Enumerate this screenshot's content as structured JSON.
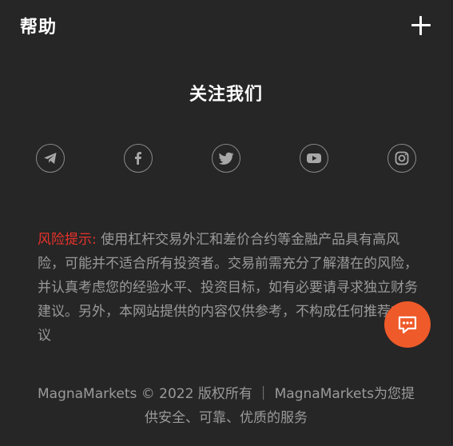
{
  "help": {
    "title": "帮助",
    "expand_icon": "plus-icon"
  },
  "follow": {
    "title": "关注我们",
    "icons": [
      "telegram-icon",
      "facebook-icon",
      "twitter-icon",
      "youtube-icon",
      "instagram-icon"
    ]
  },
  "risk": {
    "label": "风险提示:",
    "text": " 使用杠杆交易外汇和差价合约等金融产品具有高风险，可能并不适合所有投资者。交易前需充分了解潜在的风险，并认真考虑您的经验水平、投资目标，如有必要请寻求独立财务建议。另外，本网站提供的内容仅供参考，不构成任何推荐或建议"
  },
  "chat": {
    "icon": "chat-bubble-icon"
  },
  "footer": {
    "copyright": "MagnaMarkets © 2022 版权所有 ｜ MagnaMarkets为您提供安全、可靠、优质的服务"
  },
  "colors": {
    "background": "#262626",
    "risk_label": "#e8322b",
    "chat_button": "#ef5a2a",
    "text": "#9a9a9a"
  }
}
